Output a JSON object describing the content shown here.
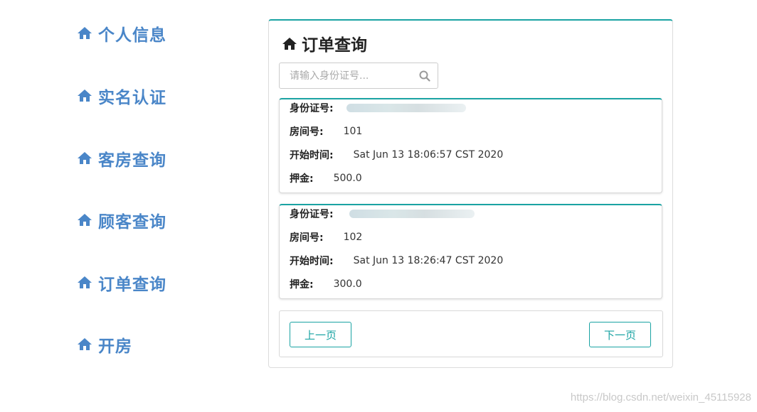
{
  "sidebar": {
    "items": [
      {
        "label": "个人信息",
        "icon": "home-icon"
      },
      {
        "label": "实名认证",
        "icon": "home-icon"
      },
      {
        "label": "客房查询",
        "icon": "home-icon"
      },
      {
        "label": "顾客查询",
        "icon": "home-icon"
      },
      {
        "label": "订单查询",
        "icon": "home-icon"
      },
      {
        "label": "开房",
        "icon": "home-icon"
      }
    ]
  },
  "main": {
    "title": "订单查询",
    "search": {
      "placeholder": "请输入身份证号...",
      "value": ""
    },
    "fields": {
      "id_label": "身份证号:",
      "room_label": "房间号:",
      "start_label": "开始时间:",
      "deposit_label": "押金:"
    },
    "orders": [
      {
        "room": "101",
        "start": "Sat Jun 13 18:06:57 CST 2020",
        "deposit": "500.0"
      },
      {
        "room": "102",
        "start": "Sat Jun 13 18:26:47 CST 2020",
        "deposit": "300.0"
      }
    ],
    "pagination": {
      "prev": "上一页",
      "next": "下一页"
    }
  },
  "watermark": "https://blog.csdn.net/weixin_45115928",
  "colors": {
    "accent": "#1aa3a3",
    "nav": "#4a86c8"
  }
}
